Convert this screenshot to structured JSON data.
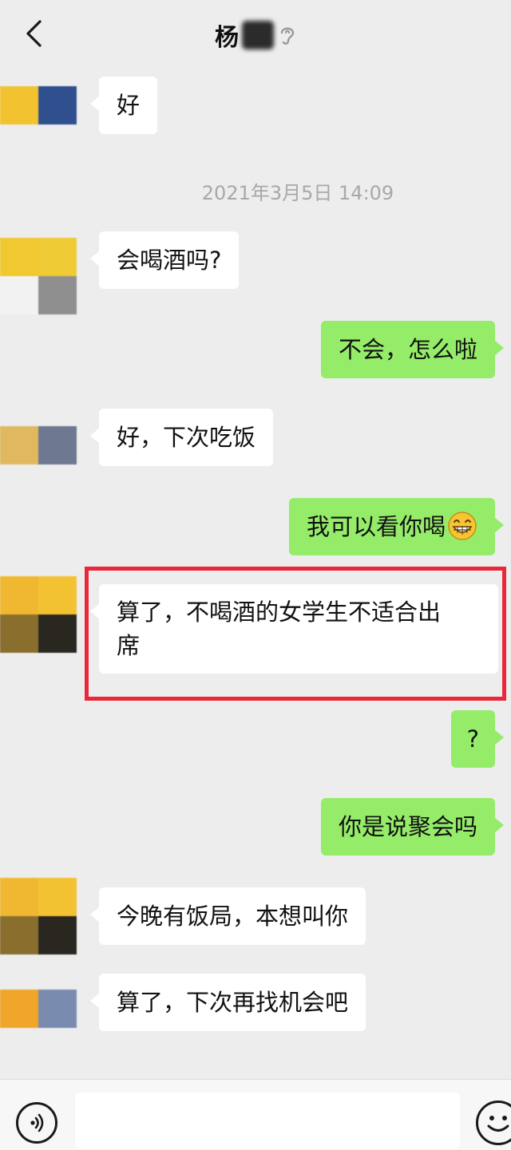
{
  "header": {
    "title": "杨",
    "back_icon": "chevron-left-icon",
    "ear_icon": "ear-icon"
  },
  "timestamp": "2021年3月5日 14:09",
  "messages": [
    {
      "side": "in",
      "text": "好"
    },
    {
      "side": "in",
      "text": "会喝酒吗?"
    },
    {
      "side": "out",
      "text": "不会，怎么啦"
    },
    {
      "side": "in",
      "text": "好，下次吃饭"
    },
    {
      "side": "out",
      "text": "我可以看你喝"
    },
    {
      "side": "in",
      "text": "算了，不喝酒的女学生不适合出",
      "text2": "席"
    },
    {
      "side": "out",
      "text": "?"
    },
    {
      "side": "out",
      "text": "你是说聚会吗"
    },
    {
      "side": "in",
      "text": "今晚有饭局，本想叫你"
    },
    {
      "side": "in",
      "text": "算了，下次再找机会吧"
    }
  ],
  "colors": {
    "background": "#ededed",
    "outgoing_bubble": "#95ec69",
    "incoming_bubble": "#ffffff",
    "highlight": "#e8283a",
    "timestamp": "#a8a8a8"
  },
  "bottom_bar": {
    "voice_icon": "voice-icon",
    "emoji_icon": "emoji-icon"
  }
}
